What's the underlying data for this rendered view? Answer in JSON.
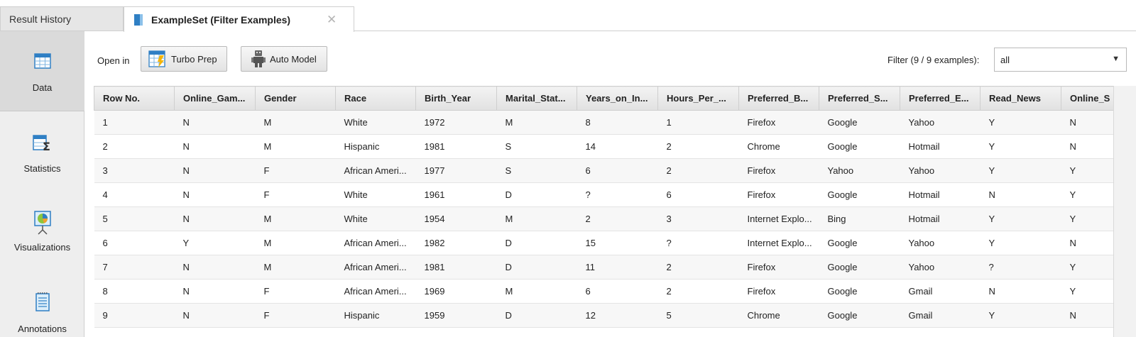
{
  "tabs": [
    {
      "label": "Result History",
      "active": false
    },
    {
      "label": "ExampleSet (Filter Examples)",
      "active": true
    }
  ],
  "sidebar": {
    "items": [
      {
        "label": "Data",
        "icon": "table-icon",
        "active": true
      },
      {
        "label": "Statistics",
        "icon": "statistics-icon",
        "active": false
      },
      {
        "label": "Visualizations",
        "icon": "chart-icon",
        "active": false
      },
      {
        "label": "Annotations",
        "icon": "notes-icon",
        "active": false
      }
    ]
  },
  "toolbar": {
    "open_in": "Open in",
    "turbo_prep": "Turbo Prep",
    "auto_model": "Auto Model",
    "filter_label": "Filter (9 / 9 examples):",
    "filter_value": "all"
  },
  "table": {
    "columns": [
      "Row No.",
      "Online_Gam...",
      "Gender",
      "Race",
      "Birth_Year",
      "Marital_Stat...",
      "Years_on_In...",
      "Hours_Per_...",
      "Preferred_B...",
      "Preferred_S...",
      "Preferred_E...",
      "Read_News",
      "Online_S"
    ],
    "rows": [
      [
        "1",
        "N",
        "M",
        "White",
        "1972",
        "M",
        "8",
        "1",
        "Firefox",
        "Google",
        "Yahoo",
        "Y",
        "N"
      ],
      [
        "2",
        "N",
        "M",
        "Hispanic",
        "1981",
        "S",
        "14",
        "2",
        "Chrome",
        "Google",
        "Hotmail",
        "Y",
        "N"
      ],
      [
        "3",
        "N",
        "F",
        "African Ameri...",
        "1977",
        "S",
        "6",
        "2",
        "Firefox",
        "Yahoo",
        "Yahoo",
        "Y",
        "Y"
      ],
      [
        "4",
        "N",
        "F",
        "White",
        "1961",
        "D",
        "?",
        "6",
        "Firefox",
        "Google",
        "Hotmail",
        "N",
        "Y"
      ],
      [
        "5",
        "N",
        "M",
        "White",
        "1954",
        "M",
        "2",
        "3",
        "Internet Explo...",
        "Bing",
        "Hotmail",
        "Y",
        "Y"
      ],
      [
        "6",
        "Y",
        "M",
        "African Ameri...",
        "1982",
        "D",
        "15",
        "?",
        "Internet Explo...",
        "Google",
        "Yahoo",
        "Y",
        "N"
      ],
      [
        "7",
        "N",
        "M",
        "African Ameri...",
        "1981",
        "D",
        "11",
        "2",
        "Firefox",
        "Google",
        "Yahoo",
        "?",
        "Y"
      ],
      [
        "8",
        "N",
        "F",
        "African Ameri...",
        "1969",
        "M",
        "6",
        "2",
        "Firefox",
        "Google",
        "Gmail",
        "N",
        "Y"
      ],
      [
        "9",
        "N",
        "F",
        "Hispanic",
        "1959",
        "D",
        "12",
        "5",
        "Chrome",
        "Google",
        "Gmail",
        "Y",
        "N"
      ]
    ]
  },
  "colors": {
    "accent": "#2f7fc4",
    "header_bg": "#e8e8e8",
    "sidebar_bg": "#eeeeee"
  }
}
